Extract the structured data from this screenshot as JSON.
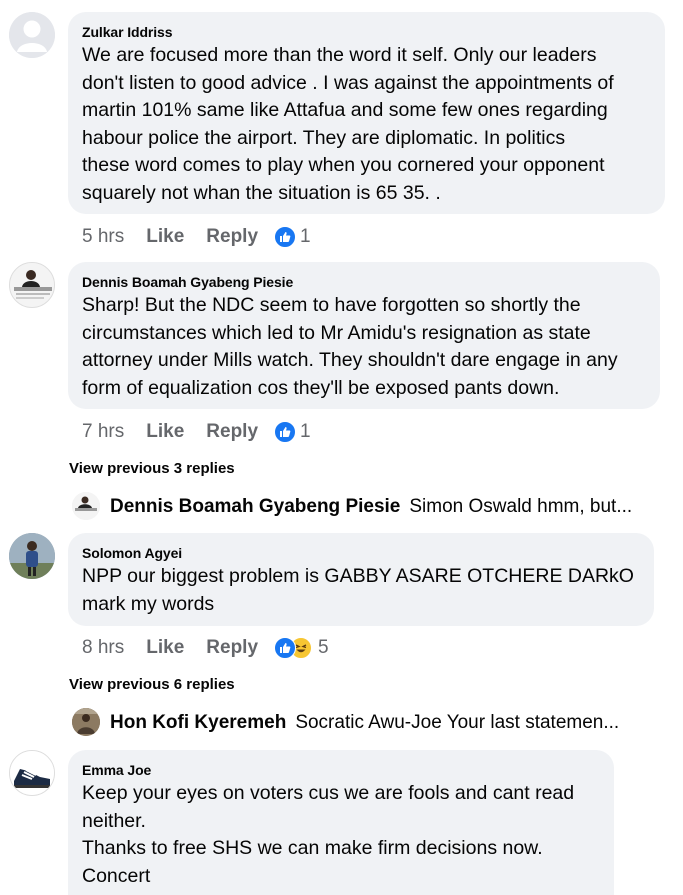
{
  "comments": [
    {
      "author": "Zulkar Iddriss",
      "text": "We are focused more than the word it self.  Only our leaders\ndon't listen to good advice . I was against the appointments of\nmartin 101% same like Attafua and some few ones regarding\nhabour police the airport.  They are diplomatic.  In politics\nthese word comes to play when you cornered your opponent\nsquarely not whan the situation is 65 35. .",
      "time": "5 hrs",
      "like_label": "Like",
      "reply_label": "Reply",
      "reaction_count": "1"
    },
    {
      "author": "Dennis Boamah Gyabeng Piesie",
      "text": "Sharp! But the NDC seem to have forgotten so shortly the\ncircumstances which led to Mr Amidu's resignation as state\nattorney under Mills watch. They shouldn't dare engage in any\nform of equalization cos they'll be exposed pants down.",
      "time": "7 hrs",
      "like_label": "Like",
      "reply_label": "Reply",
      "reaction_count": "1",
      "view_previous": "View previous 3 replies",
      "reply_preview": {
        "author": "Dennis Boamah Gyabeng Piesie",
        "text": "Simon Oswald hmm, but..."
      }
    },
    {
      "author": "Solomon Agyei",
      "text": "NPP our biggest problem is GABBY ASARE OTCHERE DARkO\nmark my words",
      "time": "8 hrs",
      "like_label": "Like",
      "reply_label": "Reply",
      "reaction_count": "5",
      "view_previous": "View previous 6 replies",
      "reply_preview": {
        "author": "Hon Kofi Kyeremeh",
        "text": "Socratic Awu-Joe Your last statemen..."
      }
    },
    {
      "author": "Emma Joe",
      "text": "Keep your eyes on voters cus we are fools and cant read\nneither.\nThanks to free SHS we can make firm decisions now.\nConcert"
    }
  ],
  "colors": {
    "bubble_bg": "#f0f2f5",
    "meta_text": "#65676b",
    "like_blue": "#1877f2",
    "haha_yellow": "#f7c632"
  },
  "icons": {
    "like": "thumbs-up-icon",
    "haha": "haha-emoji-icon",
    "default_avatar": "default-user-avatar"
  }
}
